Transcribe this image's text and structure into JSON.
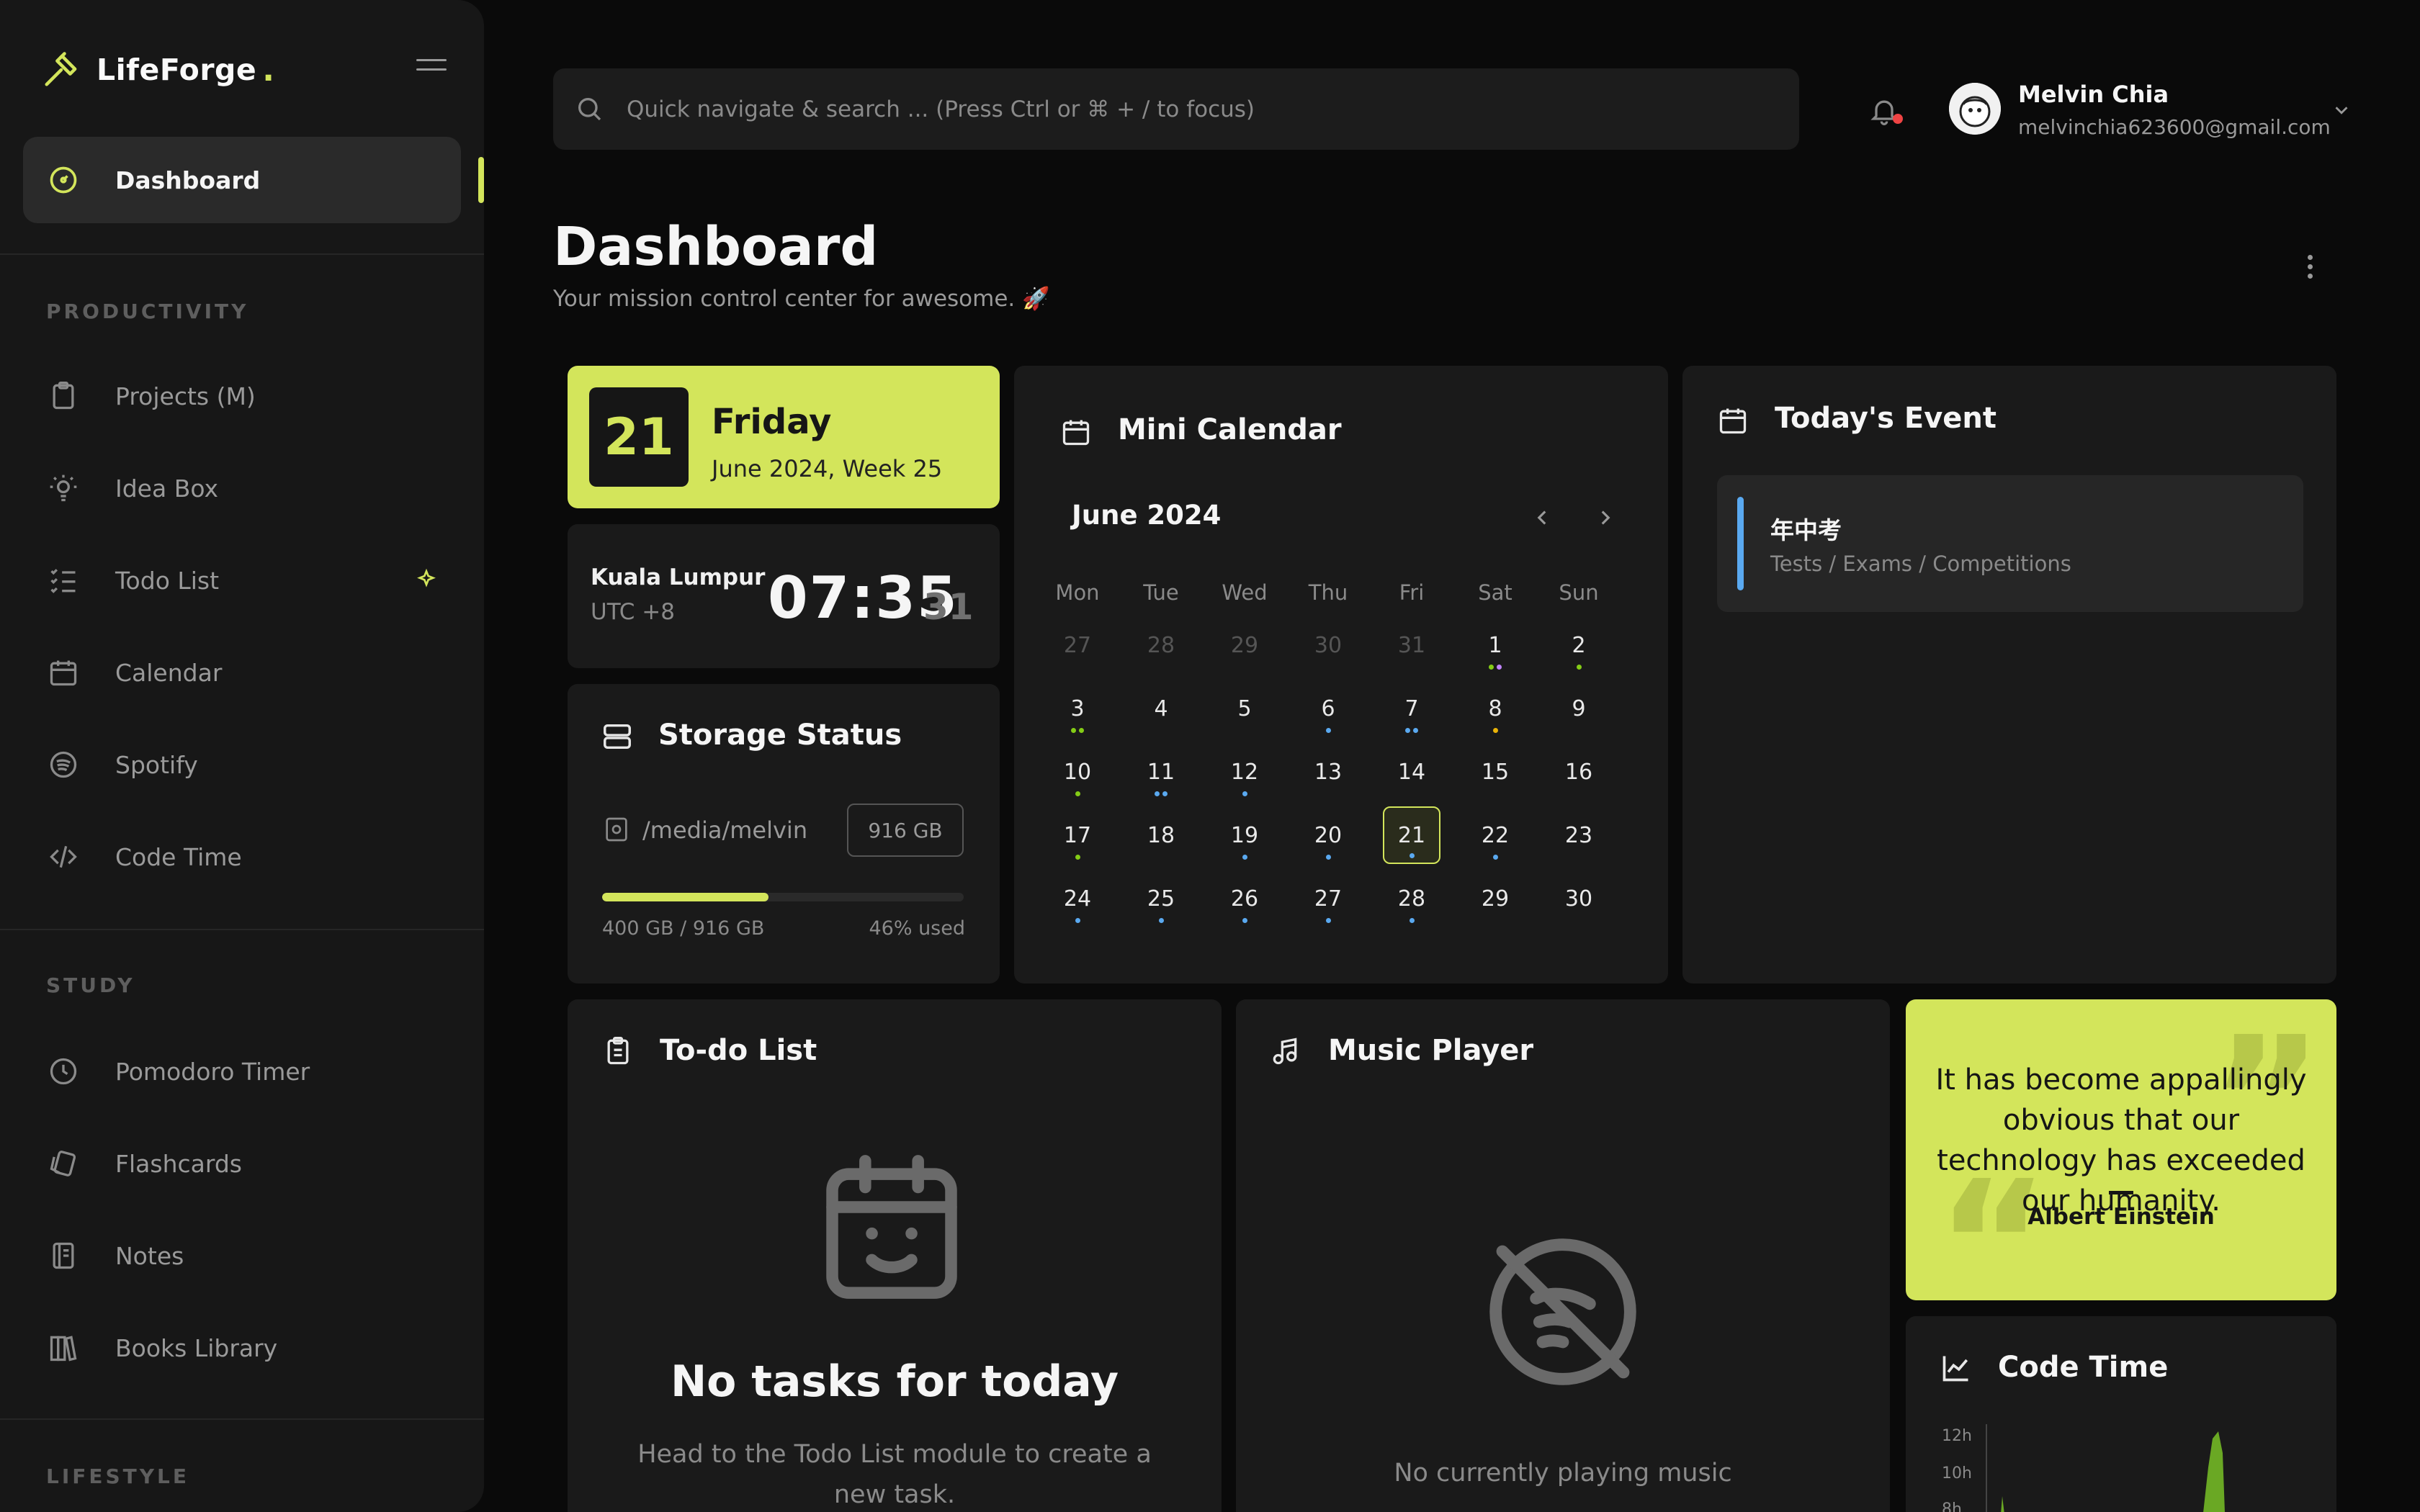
{
  "app": {
    "name": "LifeForge",
    "accent": "#d3e55b"
  },
  "sidebar": {
    "dashboard_label": "Dashboard",
    "sections": [
      {
        "title": "PRODUCTIVITY",
        "items": [
          {
            "label": "Projects (M)",
            "icon": "clipboard-icon"
          },
          {
            "label": "Idea Box",
            "icon": "bulb-icon"
          },
          {
            "label": "Todo List",
            "icon": "list-check-icon"
          },
          {
            "label": "Calendar",
            "icon": "calendar-icon"
          },
          {
            "label": "Spotify",
            "icon": "spotify-icon"
          },
          {
            "label": "Code Time",
            "icon": "code-icon"
          }
        ]
      },
      {
        "title": "STUDY",
        "items": [
          {
            "label": "Pomodoro Timer",
            "icon": "clock-icon"
          },
          {
            "label": "Flashcards",
            "icon": "cards-icon"
          },
          {
            "label": "Notes",
            "icon": "notebook-icon"
          },
          {
            "label": "Books Library",
            "icon": "books-icon"
          }
        ]
      },
      {
        "title": "LIFESTYLE",
        "items": []
      }
    ]
  },
  "search": {
    "placeholder": "Quick navigate & search ... (Press Ctrl or ⌘ + / to focus)"
  },
  "user": {
    "name": "Melvin Chia",
    "email": "melvinchia623600@gmail.com"
  },
  "page": {
    "title": "Dashboard",
    "subtitle": "Your mission control center for awesome. 🚀"
  },
  "date_widget": {
    "day_number": "21",
    "weekday": "Friday",
    "subtitle": "June 2024, Week 25"
  },
  "clock": {
    "city": "Kuala Lumpur",
    "timezone": "UTC +8",
    "time": "07:35",
    "seconds": "31"
  },
  "storage": {
    "title": "Storage Status",
    "path": "/media/melvin",
    "total_badge": "916 GB",
    "used_text": "400 GB / 916 GB",
    "percent_text": "46% used",
    "fraction": 0.46
  },
  "calendar": {
    "title": "Mini Calendar",
    "month_label": "June 2024",
    "weekdays": [
      "Mon",
      "Tue",
      "Wed",
      "Thu",
      "Fri",
      "Sat",
      "Sun"
    ],
    "days": [
      {
        "d": "27",
        "muted": true
      },
      {
        "d": "28",
        "muted": true
      },
      {
        "d": "29",
        "muted": true
      },
      {
        "d": "30",
        "muted": true
      },
      {
        "d": "31",
        "muted": true
      },
      {
        "d": "1",
        "dots": [
          "#84cc16",
          "#c084fc"
        ]
      },
      {
        "d": "2",
        "dots": [
          "#84cc16"
        ]
      },
      {
        "d": "3",
        "dots": [
          "#84cc16",
          "#84cc16"
        ]
      },
      {
        "d": "4"
      },
      {
        "d": "5"
      },
      {
        "d": "6",
        "dots": [
          "#5aa9f0"
        ]
      },
      {
        "d": "7",
        "dots": [
          "#5aa9f0",
          "#5aa9f0"
        ]
      },
      {
        "d": "8",
        "dots": [
          "#eab308"
        ]
      },
      {
        "d": "9"
      },
      {
        "d": "10",
        "dots": [
          "#84cc16"
        ]
      },
      {
        "d": "11",
        "dots": [
          "#5aa9f0",
          "#5aa9f0"
        ]
      },
      {
        "d": "12",
        "dots": [
          "#5aa9f0"
        ]
      },
      {
        "d": "13"
      },
      {
        "d": "14"
      },
      {
        "d": "15"
      },
      {
        "d": "16"
      },
      {
        "d": "17",
        "dots": [
          "#84cc16"
        ]
      },
      {
        "d": "18"
      },
      {
        "d": "19",
        "dots": [
          "#5aa9f0"
        ]
      },
      {
        "d": "20",
        "dots": [
          "#5aa9f0"
        ]
      },
      {
        "d": "21",
        "today": true,
        "dots": [
          "#5aa9f0"
        ]
      },
      {
        "d": "22",
        "dots": [
          "#5aa9f0"
        ]
      },
      {
        "d": "23"
      },
      {
        "d": "24",
        "dots": [
          "#5aa9f0"
        ]
      },
      {
        "d": "25",
        "dots": [
          "#5aa9f0"
        ]
      },
      {
        "d": "26",
        "dots": [
          "#5aa9f0"
        ]
      },
      {
        "d": "27",
        "dots": [
          "#5aa9f0"
        ]
      },
      {
        "d": "28",
        "dots": [
          "#5aa9f0"
        ]
      },
      {
        "d": "29"
      },
      {
        "d": "30"
      }
    ]
  },
  "events": {
    "title": "Today's Event",
    "items": [
      {
        "title": "年中考",
        "category": "Tests / Exams / Competitions",
        "color": "#5aa9f0"
      }
    ]
  },
  "todo": {
    "title": "To-do List",
    "empty_title": "No tasks for today",
    "empty_subtitle": "Head to the Todo List module to create a new task."
  },
  "music": {
    "title": "Music Player",
    "empty_text": "No currently playing music"
  },
  "quote": {
    "text": "It has become appallingly obvious that our technology has exceeded our humanity.",
    "author": "Albert Einstein"
  },
  "code_time": {
    "title": "Code Time",
    "y_ticks": [
      "12h",
      "10h",
      "8h"
    ]
  }
}
